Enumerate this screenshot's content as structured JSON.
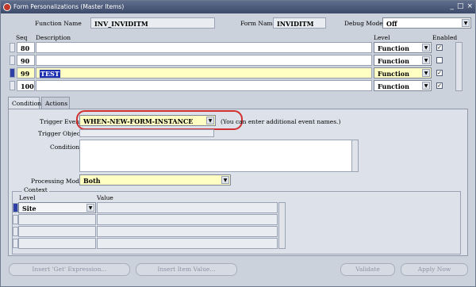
{
  "window": {
    "title": "Form Personalizations (Master Items)",
    "controls": [
      "_",
      "□",
      "×"
    ]
  },
  "header": {
    "function_name_label": "Function Name",
    "function_name_value": "INV_INVIDITM",
    "form_name_label": "Form Name",
    "form_name_value": "INVIDITM",
    "debug_mode_label": "Debug Mode",
    "debug_mode_value": "Off"
  },
  "grid": {
    "columns": {
      "seq": "Seq",
      "description": "Description",
      "level": "Level",
      "enabled": "Enabled"
    },
    "rows": [
      {
        "seq": "80",
        "description": "",
        "level": "Function",
        "enabled": true
      },
      {
        "seq": "90",
        "description": "",
        "level": "Function",
        "enabled": false
      },
      {
        "seq": "99",
        "description": "TEST",
        "level": "Function",
        "enabled": true
      },
      {
        "seq": "100",
        "description": "",
        "level": "Function",
        "enabled": true
      }
    ]
  },
  "tabs": {
    "condition": "Condition",
    "actions": "Actions"
  },
  "condition": {
    "trigger_event_label": "Trigger Event",
    "trigger_event_value": "WHEN-NEW-FORM-INSTANCE",
    "trigger_event_note": "(You can enter additional event names.)",
    "trigger_object_label": "Trigger Object",
    "condition_label": "Condition",
    "processing_mode_label": "Processing Mode",
    "processing_mode_value": "Both"
  },
  "context": {
    "group_label": "Context",
    "level_header": "Level",
    "value_header": "Value",
    "rows": [
      {
        "level": "Site",
        "value": ""
      }
    ]
  },
  "buttons": {
    "insert_get": "Insert 'Get' Expression...",
    "insert_item": "Insert Item Value...",
    "validate": "Validate",
    "apply_now": "Apply Now"
  },
  "colors": {
    "accent": "#1c2fb0",
    "highlight_oval": "#d03030",
    "yellow_field": "#ffffc4"
  }
}
